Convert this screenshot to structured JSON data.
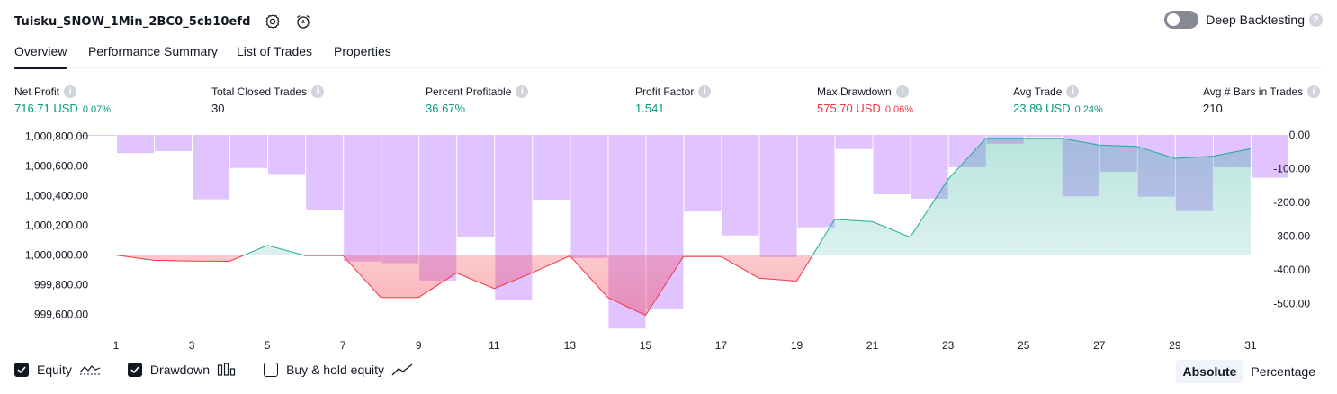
{
  "header": {
    "title": "Tuisku_SNOW_1Min_2BC0_5cb10efd",
    "icons": [
      "settings-icon",
      "alarm-add-icon"
    ],
    "deep_backtesting_label": "Deep Backtesting",
    "deep_backtesting_on": false,
    "help_glyph": "?"
  },
  "tabs": [
    {
      "label": "Overview",
      "active": true
    },
    {
      "label": "Performance Summary",
      "active": false
    },
    {
      "label": "List of Trades",
      "active": false
    },
    {
      "label": "Properties",
      "active": false
    }
  ],
  "metrics": [
    {
      "label": "Net Profit",
      "value": "716.71 USD",
      "pct": "0.07%",
      "tone": "pos"
    },
    {
      "label": "Total Closed Trades",
      "value": "30",
      "pct": "",
      "tone": "neutral"
    },
    {
      "label": "Percent Profitable",
      "value": "36.67%",
      "pct": "",
      "tone": "pos"
    },
    {
      "label": "Profit Factor",
      "value": "1.541",
      "pct": "",
      "tone": "pos"
    },
    {
      "label": "Max Drawdown",
      "value": "575.70 USD",
      "pct": "0.06%",
      "tone": "neg"
    },
    {
      "label": "Avg Trade",
      "value": "23.89 USD",
      "pct": "0.24%",
      "tone": "pos"
    },
    {
      "label": "Avg # Bars in Trades",
      "value": "210",
      "pct": "",
      "tone": "neutral"
    }
  ],
  "legend": {
    "equity": {
      "label": "Equity",
      "checked": true
    },
    "drawdown": {
      "label": "Drawdown",
      "checked": true
    },
    "buyhold": {
      "label": "Buy & hold equity",
      "checked": false
    }
  },
  "mode": {
    "absolute": "Absolute",
    "percentage": "Percentage",
    "active": "absolute"
  },
  "colors": {
    "positive": "#089981",
    "negative": "#f23645",
    "drawdown_bar": "#e1c4ff",
    "equity_up": "#22ab94",
    "equity_down": "#f23645"
  },
  "chart_data": {
    "type": "area",
    "x_ticks": [
      "1",
      "3",
      "5",
      "7",
      "9",
      "11",
      "13",
      "15",
      "17",
      "19",
      "21",
      "23",
      "25",
      "27",
      "29",
      "31"
    ],
    "y_left_ticks": [
      "1,000,800.00",
      "1,000,600.00",
      "1,000,400.00",
      "1,000,200.00",
      "1,000,000.00",
      "999,800.00",
      "999,600.00"
    ],
    "y_right_ticks": [
      "0.00",
      "-100.00",
      "-200.00",
      "-300.00",
      "-400.00",
      "-500.00"
    ],
    "ylim_left": [
      999550,
      1000820
    ],
    "ylim_right": [
      -560,
      0
    ],
    "baseline": 1000000,
    "series": [
      {
        "name": "Equity",
        "x": [
          1,
          2,
          3,
          4,
          5,
          6,
          7,
          8,
          9,
          10,
          11,
          12,
          13,
          14,
          15,
          16,
          17,
          18,
          19,
          20,
          21,
          22,
          23,
          24,
          25,
          26,
          27,
          28,
          29,
          30,
          31
        ],
        "values": [
          1000000,
          999965,
          999960,
          999958,
          1000065,
          999997,
          999997,
          999715,
          999715,
          999880,
          999775,
          999880,
          999995,
          999715,
          999595,
          999990,
          999990,
          999845,
          999825,
          1000240,
          1000225,
          1000120,
          1000510,
          1000785,
          1000785,
          1000785,
          1000740,
          1000730,
          1000650,
          1000665,
          1000715
        ]
      },
      {
        "name": "Drawdown",
        "x": [
          1,
          2,
          3,
          4,
          5,
          6,
          7,
          8,
          9,
          10,
          11,
          12,
          13,
          14,
          15,
          16,
          17,
          18,
          19,
          20,
          21,
          22,
          23,
          24,
          25,
          26,
          27,
          28,
          29,
          30,
          31,
          32
        ],
        "values": [
          -2,
          -54,
          -48,
          -191,
          -98,
          -116,
          -223,
          -375,
          -380,
          -432,
          -304,
          -491,
          -192,
          -365,
          -574,
          -515,
          -227,
          -298,
          -362,
          -274,
          -42,
          -176,
          -189,
          -96,
          -26,
          -6,
          -182,
          -109,
          -183,
          -226,
          -96,
          -127
        ]
      }
    ]
  }
}
